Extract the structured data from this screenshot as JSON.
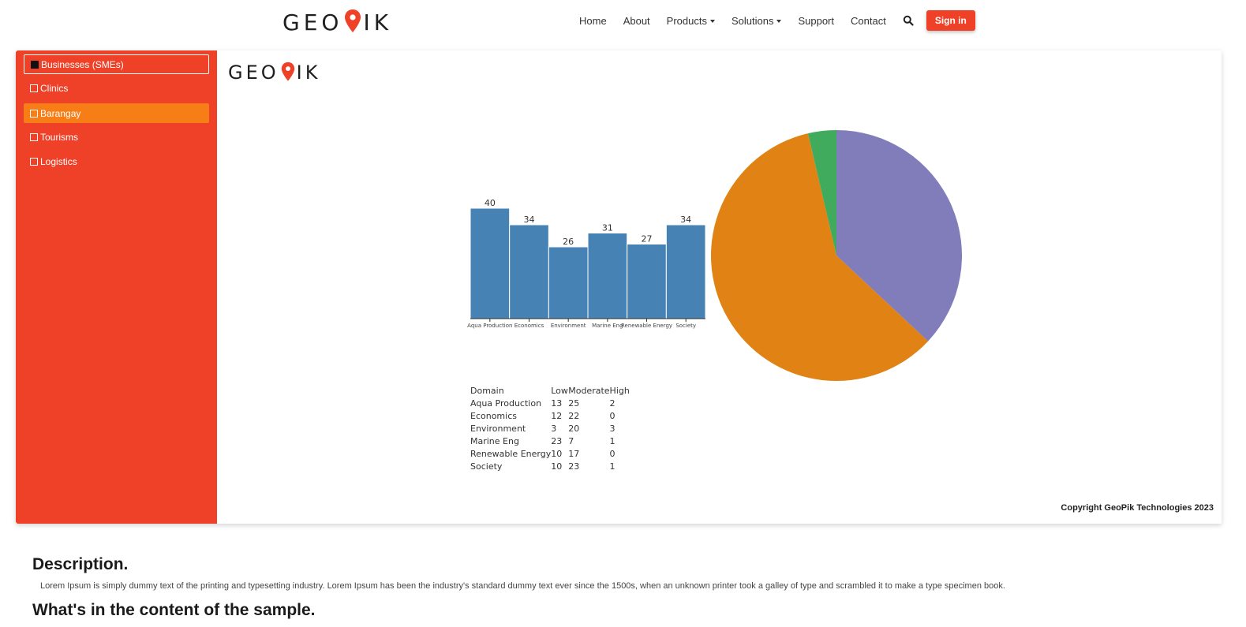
{
  "brand": {
    "left": "GEO",
    "right": "IK",
    "pin_color": "#ee4128"
  },
  "nav": {
    "items": [
      {
        "label": "Home",
        "dropdown": false
      },
      {
        "label": "About",
        "dropdown": false
      },
      {
        "label": "Products",
        "dropdown": true
      },
      {
        "label": "Solutions",
        "dropdown": true
      },
      {
        "label": "Support",
        "dropdown": false
      },
      {
        "label": "Contact",
        "dropdown": false
      }
    ],
    "search_icon": "search-icon",
    "signin_label": "Sign in"
  },
  "sidebar": {
    "color": "#ee4128",
    "active_color": "#f77d16",
    "items": [
      {
        "label": "Businesses (SMEs)",
        "checked": true,
        "state": "selected"
      },
      {
        "label": "Clinics",
        "checked": false,
        "state": "normal"
      },
      {
        "label": "Barangay",
        "checked": false,
        "state": "active"
      },
      {
        "label": "Tourisms",
        "checked": false,
        "state": "normal"
      },
      {
        "label": "Logistics",
        "checked": false,
        "state": "normal"
      }
    ]
  },
  "chart_data": [
    {
      "type": "bar",
      "categories": [
        "Aqua Production",
        "Economics",
        "Environment",
        "Marine Eng",
        "Renewable Energy",
        "Society"
      ],
      "values": [
        40,
        34,
        26,
        31,
        27,
        34
      ],
      "ylim": [
        0,
        40
      ],
      "color": "#4682b4",
      "data_labels": true
    },
    {
      "type": "pie",
      "labels": [
        "Low",
        "Moderate",
        "High"
      ],
      "values": [
        71,
        114,
        7
      ],
      "colors": [
        "#807dba",
        "#e08214",
        "#41ab5d"
      ]
    },
    {
      "type": "table",
      "columns": [
        "Domain",
        "Low",
        "Moderate",
        "High"
      ],
      "rows": [
        [
          "Aqua Production",
          "13",
          "25",
          "2"
        ],
        [
          "Economics",
          "12",
          "22",
          "0"
        ],
        [
          "Environment",
          "3",
          "20",
          "3"
        ],
        [
          "Marine Eng",
          "23",
          "7",
          "1"
        ],
        [
          "Renewable Energy",
          "10",
          "17",
          "0"
        ],
        [
          "Society",
          "10",
          "23",
          "1"
        ]
      ]
    }
  ],
  "copyright": "Copyright GeoPik Technologies 2023",
  "description": {
    "title": "Description.",
    "text": "Lorem Ipsum is simply dummy text of the printing and typesetting industry. Lorem Ipsum has been the industry's standard dummy text ever since the 1500s, when an unknown printer took a galley of type and scrambled it to make a type specimen book."
  },
  "whats_in_title": "What's in the content of the sample."
}
